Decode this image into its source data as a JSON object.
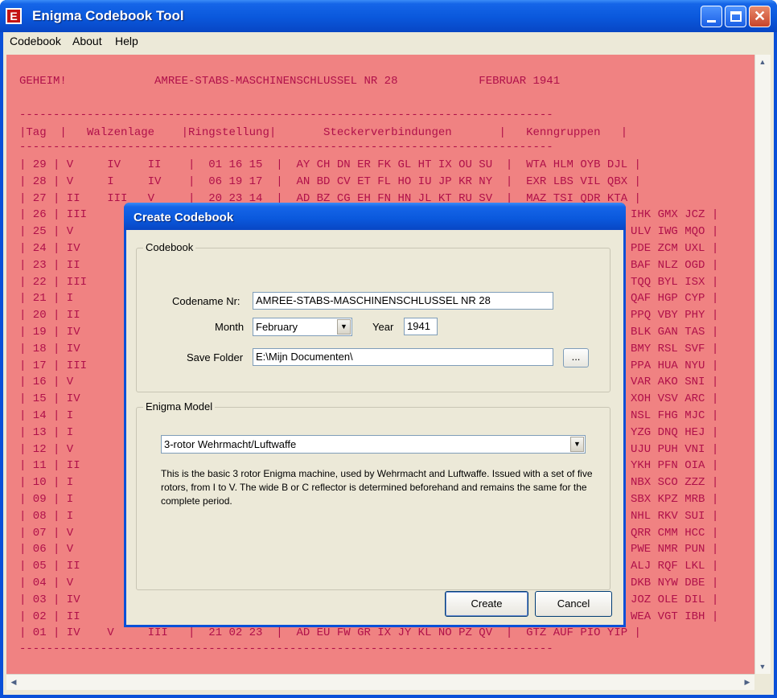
{
  "window": {
    "title": "Enigma Codebook Tool",
    "icon_letter": "E",
    "controls": {
      "minimize": "minimize-icon",
      "maximize": "maximize-icon",
      "close": "✕"
    }
  },
  "menubar": {
    "items": [
      "Codebook",
      "About",
      "Help"
    ]
  },
  "document": {
    "lines": [
      "GEHEIM!             AMREE-STABS-MASCHINENSCHLUSSEL NR 28            FEBRUAR 1941",
      "-------------------------------------------------------------------------------",
      "|Tag  |   Walzenlage    |Ringstellung|       Steckerverbindungen       |   Kenngruppen   |",
      "-------------------------------------------------------------------------------",
      "| 29 | V     IV    II    |  01 16 15  |  AY CH DN ER FK GL HT IX OU SU  |  WTA HLM OYB DJL |",
      "| 28 | V     I     IV    |  06 19 17  |  AN BD CV ET FL HO IU JP KR NY  |  EXR LBS VIL QBX |",
      "| 27 | II    III   V     |  20 23 14  |  AD BZ CG EH FN HN JL KT RU SV  |  MAZ TSI QDR KTA |",
      "| 26 | III",
      "| 25 | V",
      "| 24 | IV",
      "| 23 | II",
      "| 22 | III",
      "| 21 | I",
      "| 20 | II",
      "| 19 | IV",
      "| 18 | IV",
      "| 17 | III",
      "| 16 | V",
      "| 15 | IV",
      "| 14 | I",
      "| 13 | I",
      "| 12 | V",
      "| 11 | II",
      "| 10 | I",
      "| 09 | I",
      "| 08 | I",
      "| 07 | V",
      "| 06 | V",
      "| 05 | II",
      "| 04 | V",
      "| 03 | IV",
      "| 02 | II",
      "| 01 | IV    V     III   |  21 02 23  |  AD EU FW GR IX JY KL NO PZ QV  |  GTZ AUF PIO YIP |",
      "-------------------------------------------------------------------------------"
    ],
    "right_column": [
      "IHK GMX JCZ |",
      "ULV IWG MQO |",
      "PDE ZCM UXL |",
      "BAF NLZ OGD |",
      "TQQ BYL ISX |",
      "QAF HGP CYP |",
      "PPQ VBY PHY |",
      "BLK GAN TAS |",
      "BMY RSL SVF |",
      "PPA HUA NYU |",
      "VAR AKO SNI |",
      "XOH VSV ARC |",
      "NSL FHG MJC |",
      "YZG DNQ HEJ |",
      "UJU PUH VNI |",
      "YKH PFN OIA |",
      "NBX SCO ZZZ |",
      "SBX KPZ MRB |",
      "NHL RKV SUI |",
      "QRR CMM HCC |",
      "PWE NMR PUN |",
      "ALJ RQF LKL |",
      "DKB NYW DBE |",
      "JOZ OLE DIL |",
      "WEA VGT IBH |"
    ]
  },
  "dialog": {
    "title": "Create Codebook",
    "codebook_group": {
      "label": "Codebook",
      "codename_label": "Codename Nr:",
      "codename_value": "AMREE-STABS-MASCHINENSCHLUSSEL NR 28",
      "month_label": "Month",
      "month_value": "February",
      "year_label": "Year",
      "year_value": "1941",
      "folder_label": "Save Folder",
      "folder_value": "E:\\Mijn Documenten\\",
      "browse_label": "..."
    },
    "model_group": {
      "label": "Enigma Model",
      "model_value": "3-rotor Wehrmacht/Luftwaffe",
      "description": "This is the basic 3 rotor Enigma machine, used by Wehrmacht and Luftwaffe. Issued with a set of five rotors, from I to V. The wide B or C reflector is determined beforehand and remains the same for the complete period."
    },
    "buttons": {
      "create": "Create",
      "cancel": "Cancel"
    }
  },
  "colors": {
    "titlebar": "#0a58dc",
    "document_bg": "#f08282",
    "document_text": "#b0104a",
    "dialog_bg": "#ece9d8"
  }
}
